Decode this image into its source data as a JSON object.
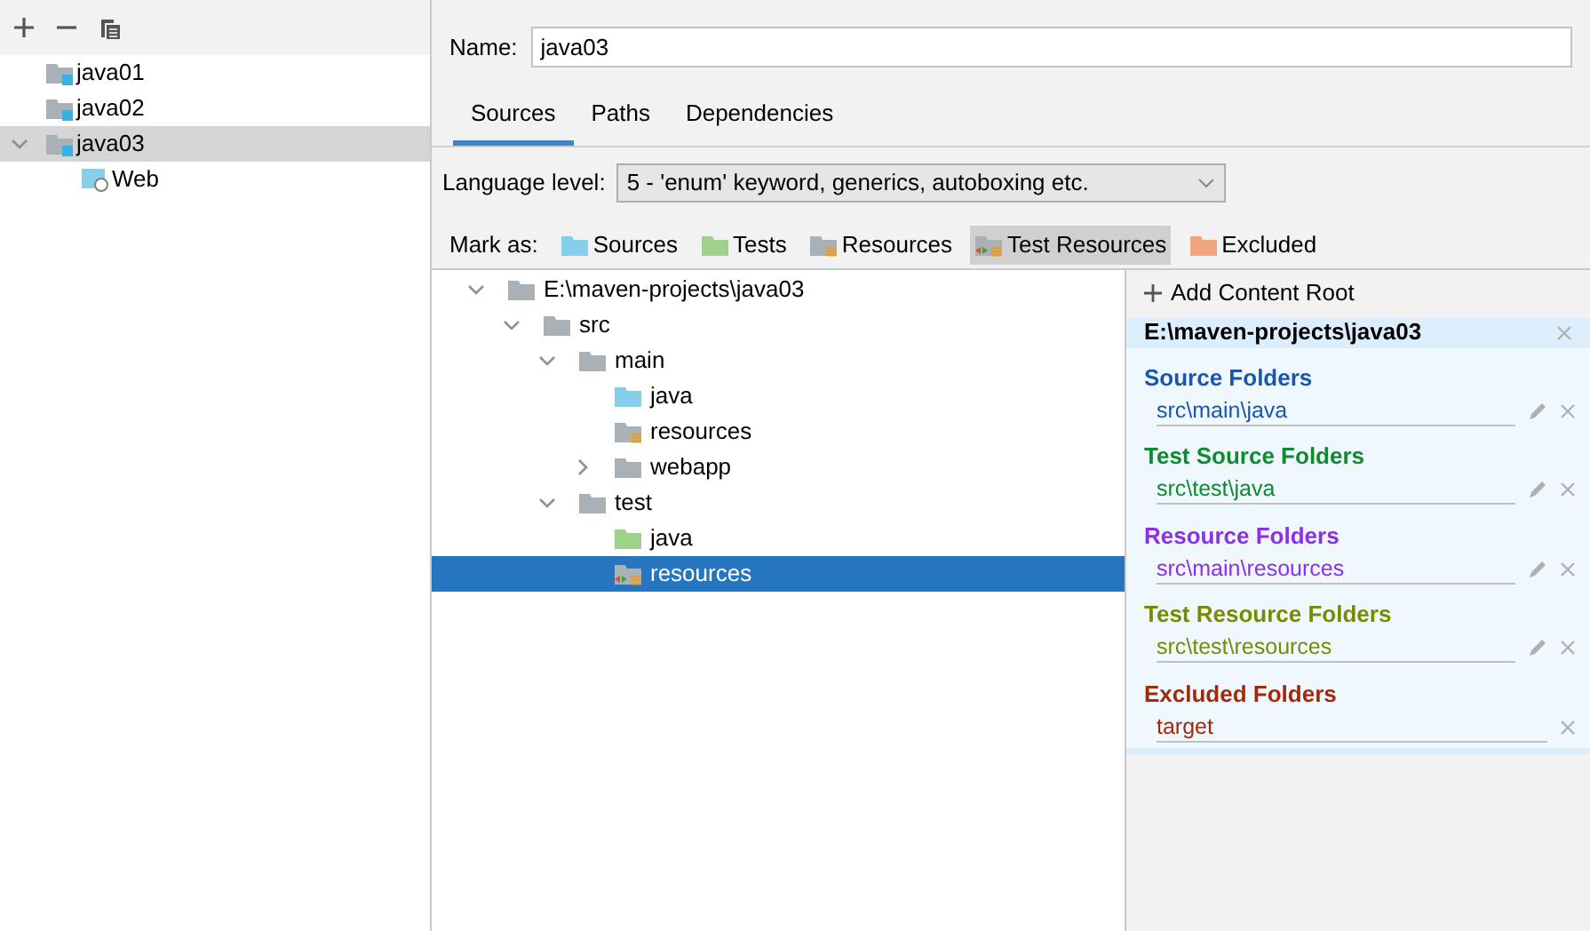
{
  "modules": [
    {
      "name": "java01",
      "kind": "module",
      "selected": false
    },
    {
      "name": "java02",
      "kind": "module",
      "selected": false
    },
    {
      "name": "java03",
      "kind": "module",
      "selected": true,
      "expanded": true,
      "children": [
        {
          "name": "Web",
          "kind": "web",
          "selected": false
        }
      ]
    }
  ],
  "name_field": {
    "label": "Name:",
    "value": "java03"
  },
  "tabs": [
    {
      "label": "Sources",
      "selected": true
    },
    {
      "label": "Paths",
      "selected": false
    },
    {
      "label": "Dependencies",
      "selected": false
    }
  ],
  "language_level": {
    "label": "Language level:",
    "value": "5 - 'enum' keyword, generics, autoboxing etc."
  },
  "mark_as": {
    "label": "Mark as:",
    "buttons": [
      {
        "label": "Sources",
        "kind": "source",
        "selected": false
      },
      {
        "label": "Tests",
        "kind": "test",
        "selected": false
      },
      {
        "label": "Resources",
        "kind": "resource",
        "selected": false
      },
      {
        "label": "Test Resources",
        "kind": "test_resource",
        "selected": true
      },
      {
        "label": "Excluded",
        "kind": "excluded",
        "selected": false
      }
    ]
  },
  "tree": [
    {
      "name": "E:\\maven-projects\\java03",
      "kind": "plain",
      "expanded": true,
      "selected": false,
      "children": [
        {
          "name": "src",
          "kind": "plain",
          "expanded": true,
          "selected": false,
          "children": [
            {
              "name": "main",
              "kind": "plain",
              "expanded": true,
              "selected": false,
              "children": [
                {
                  "name": "java",
                  "kind": "source",
                  "selected": false
                },
                {
                  "name": "resources",
                  "kind": "resource",
                  "selected": false
                },
                {
                  "name": "webapp",
                  "kind": "plain",
                  "expanded": false,
                  "selected": false
                }
              ]
            },
            {
              "name": "test",
              "kind": "plain",
              "expanded": true,
              "selected": false,
              "children": [
                {
                  "name": "java",
                  "kind": "test",
                  "selected": false
                },
                {
                  "name": "resources",
                  "kind": "test_resource",
                  "selected": true
                }
              ]
            }
          ]
        }
      ]
    }
  ],
  "content_root": {
    "add_label": "Add Content Root",
    "path": "E:\\maven-projects\\java03",
    "groups": [
      {
        "title": "Source Folders",
        "color": "#1a55b0",
        "entries": [
          {
            "path": "src\\main\\java",
            "editable": true
          }
        ]
      },
      {
        "title": "Test Source Folders",
        "color": "#108a2e",
        "entries": [
          {
            "path": "src\\test\\java",
            "editable": true
          }
        ]
      },
      {
        "title": "Resource Folders",
        "color": "#8c2fe6",
        "entries": [
          {
            "path": "src\\main\\resources",
            "editable": true
          }
        ]
      },
      {
        "title": "Test Resource Folders",
        "color": "#7a8a00",
        "entries": [
          {
            "path": "src\\test\\resources",
            "editable": true
          }
        ]
      },
      {
        "title": "Excluded Folders",
        "color": "#a12a0a",
        "entries": [
          {
            "path": "target",
            "editable": false
          }
        ]
      }
    ]
  }
}
